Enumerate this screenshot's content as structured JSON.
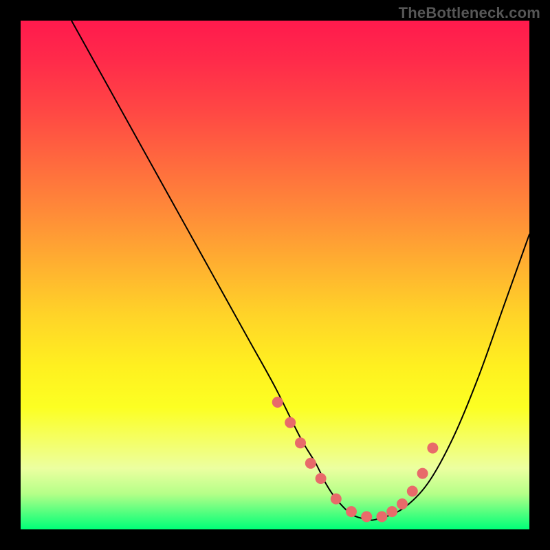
{
  "watermark": "TheBottleneck.com",
  "chart_data": {
    "type": "line",
    "title": "",
    "xlabel": "",
    "ylabel": "",
    "xlim": [
      0,
      100
    ],
    "ylim": [
      0,
      100
    ],
    "grid": false,
    "series": [
      {
        "name": "curve",
        "x": [
          10,
          15,
          20,
          25,
          30,
          35,
          40,
          45,
          50,
          55,
          58,
          60,
          62,
          65,
          68,
          70,
          75,
          80,
          85,
          90,
          95,
          100
        ],
        "y": [
          100,
          91,
          82,
          73,
          64,
          55,
          46,
          37,
          28,
          18,
          13,
          9,
          6,
          3,
          2,
          2,
          4,
          9,
          18,
          30,
          44,
          58
        ]
      }
    ],
    "markers": {
      "name": "highlight-zone",
      "color": "#e86a6a",
      "radius": 8,
      "x": [
        50.5,
        53,
        55,
        57,
        59,
        62,
        65,
        68,
        71,
        73,
        75,
        77,
        79,
        81
      ],
      "y": [
        25,
        21,
        17,
        13,
        10,
        6,
        3.5,
        2.5,
        2.5,
        3.5,
        5,
        7.5,
        11,
        16
      ]
    },
    "background_gradient": {
      "top": "#ff1a4d",
      "bottom": "#00ff78"
    }
  }
}
